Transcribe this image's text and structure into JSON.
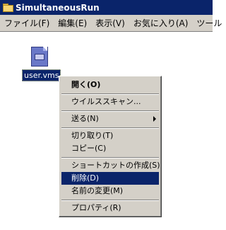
{
  "window": {
    "title": "SimultaneousRun",
    "menubar": [
      "ファイル(F)",
      "編集(E)",
      "表示(V)",
      "お気に入り(A)",
      "ツール"
    ]
  },
  "file": {
    "name": "user.vms",
    "icon": "vms-file-icon"
  },
  "context_menu": {
    "items": [
      {
        "label": "開く(O)",
        "default": true
      },
      {
        "separator": true
      },
      {
        "label": "ウイルススキャン..."
      },
      {
        "separator": true
      },
      {
        "label": "送る(N)",
        "submenu": true
      },
      {
        "separator": true
      },
      {
        "label": "切り取り(T)"
      },
      {
        "label": "コピー(C)"
      },
      {
        "separator": true
      },
      {
        "label": "ショートカットの作成(S)"
      },
      {
        "label": "削除(D)",
        "selected": true
      },
      {
        "label": "名前の変更(M)"
      },
      {
        "separator": true
      },
      {
        "label": "プロパティ(R)"
      }
    ]
  },
  "colors": {
    "title_bg": "#0a246a",
    "menu_bg": "#d4d0c8",
    "selection": "#0a246a"
  }
}
